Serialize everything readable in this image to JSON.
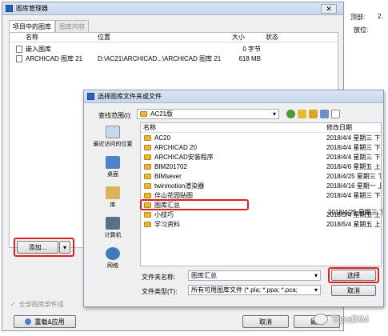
{
  "background_panel": {
    "label_top": "顶部:",
    "value_top": "2.",
    "label_location": "放位:"
  },
  "library_manager": {
    "title": "图库管理器",
    "close": "✕",
    "tabs": [
      {
        "label": "项目中的图库"
      },
      {
        "label": "图库内容"
      }
    ],
    "columns": {
      "name": "名称",
      "location": "位置",
      "size": "大小",
      "status": "状态"
    },
    "rows": [
      {
        "name": "嵌入图库",
        "location": "",
        "size": "0 字节",
        "status": ""
      },
      {
        "name": "ARCHICAD 图库 21",
        "location": "D:\\AC21\\ARCHICAD...\\ARCHICAD 图库 21",
        "size": "618 MB",
        "status": ""
      }
    ],
    "add_button": "添加...",
    "add_dropdown": "▾",
    "bottom_hint": "全部图库部件成",
    "reload_button": "重载&应用",
    "cancel_button": "取消",
    "ok_button": "确定"
  },
  "file_dialog": {
    "title": "选择图库文件夹或文件",
    "lookin_label": "查找范围(I):",
    "lookin_value": "AC21版",
    "col_name": "名称",
    "col_modified": "修改日期",
    "places": [
      {
        "label": "最近访问的位置",
        "icon": "recent-places-icon"
      },
      {
        "label": "桌面",
        "icon": "desktop-icon"
      },
      {
        "label": "库",
        "icon": "libraries-icon"
      },
      {
        "label": "计算机",
        "icon": "computer-icon"
      },
      {
        "label": "网络",
        "icon": "network-icon"
      }
    ],
    "files": [
      {
        "name": "AC20",
        "date": "2018/4/4 星期三 下"
      },
      {
        "name": "ARCHICAD 20",
        "date": "2018/4/4 星期三 下"
      },
      {
        "name": "ARCHICAD安装程序",
        "date": "2018/4/4 星期三 下"
      },
      {
        "name": "BIM201702",
        "date": "2018/4/6 星期五 上"
      },
      {
        "name": "BIMsever",
        "date": "2018/4/25 星期三 下"
      },
      {
        "name": "twinmotion渲染器",
        "date": "2018/4/16 星期一 上"
      },
      {
        "name": "伴山花园贴图",
        "date": "2018/4/4 星期三 下"
      },
      {
        "name": "图库汇总",
        "date": "2018/4/25 星期三 下"
      },
      {
        "name": "小技巧",
        "date": "2018/5/4 星期五 上"
      },
      {
        "name": "学习资料",
        "date": "2018/5/4 星期五 上"
      }
    ],
    "filename_label": "文件夹名称:",
    "filename_value": "图库汇总",
    "filetype_label": "文件类型(T):",
    "filetype_value": "所有可用图库文件 (*.pla; *.ppa; *.pca;",
    "select_button": "选择",
    "cancel_button": "取消"
  },
  "watermark": "TopsBIM"
}
